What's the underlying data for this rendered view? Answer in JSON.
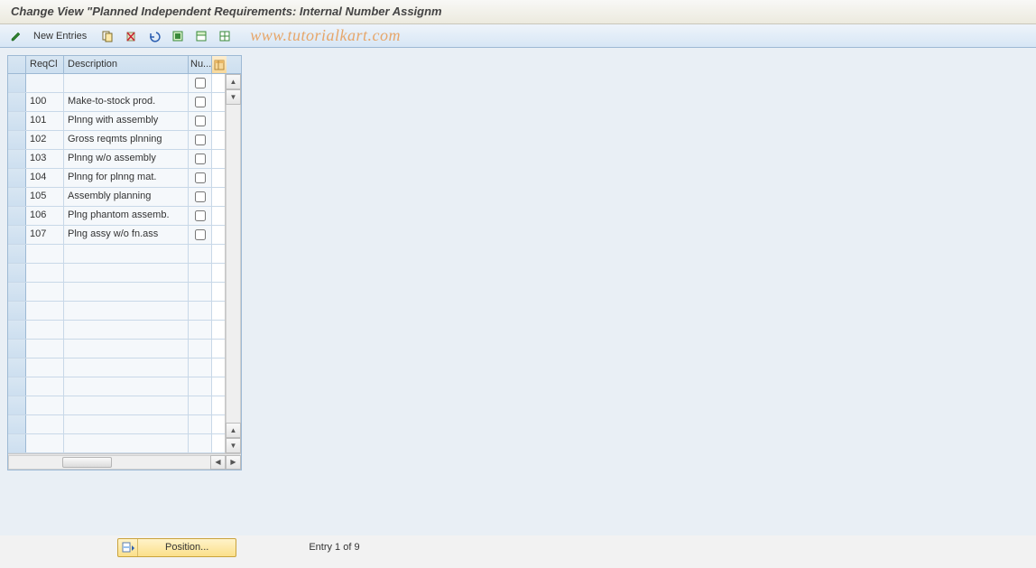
{
  "title": "Change View \"Planned Independent Requirements: Internal Number Assignm",
  "toolbar": {
    "new_entries_label": "New Entries"
  },
  "watermark": "www.tutorialkart.com",
  "grid": {
    "columns": {
      "reqcl": "ReqCl",
      "desc": "Description",
      "nu": "Nu..."
    },
    "rows": [
      {
        "reqcl": "",
        "desc": "",
        "nu": false
      },
      {
        "reqcl": "100",
        "desc": "Make-to-stock prod.",
        "nu": false
      },
      {
        "reqcl": "101",
        "desc": "Plnng with assembly",
        "nu": false
      },
      {
        "reqcl": "102",
        "desc": "Gross reqmts plnning",
        "nu": false
      },
      {
        "reqcl": "103",
        "desc": "Plnng w/o assembly",
        "nu": false
      },
      {
        "reqcl": "104",
        "desc": "Plnng for plnng mat.",
        "nu": false
      },
      {
        "reqcl": "105",
        "desc": "Assembly planning",
        "nu": false
      },
      {
        "reqcl": "106",
        "desc": "Plng phantom assemb.",
        "nu": false
      },
      {
        "reqcl": "107",
        "desc": "Plng assy w/o fn.ass",
        "nu": false
      },
      {
        "reqcl": "",
        "desc": "",
        "nu": null
      },
      {
        "reqcl": "",
        "desc": "",
        "nu": null
      },
      {
        "reqcl": "",
        "desc": "",
        "nu": null
      },
      {
        "reqcl": "",
        "desc": "",
        "nu": null
      },
      {
        "reqcl": "",
        "desc": "",
        "nu": null
      },
      {
        "reqcl": "",
        "desc": "",
        "nu": null
      },
      {
        "reqcl": "",
        "desc": "",
        "nu": null
      },
      {
        "reqcl": "",
        "desc": "",
        "nu": null
      },
      {
        "reqcl": "",
        "desc": "",
        "nu": null
      },
      {
        "reqcl": "",
        "desc": "",
        "nu": null
      },
      {
        "reqcl": "",
        "desc": "",
        "nu": null
      }
    ]
  },
  "position_button_label": "Position...",
  "entry_status": "Entry 1 of 9"
}
